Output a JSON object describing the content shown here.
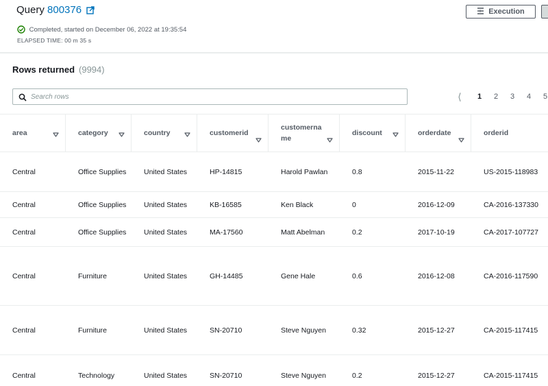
{
  "query": {
    "label": "Query",
    "id": "800376"
  },
  "status": {
    "text": "Completed, started on December 06, 2022 at 19:35:54",
    "elapsed": "ELAPSED TIME: 00 m 35 s"
  },
  "execution_button": {
    "label": "Execution"
  },
  "rows": {
    "title": "Rows returned",
    "count": "(9994)"
  },
  "search": {
    "placeholder": "Search rows"
  },
  "pagination": {
    "pages": [
      "1",
      "2",
      "3",
      "4",
      "5"
    ],
    "current": "1"
  },
  "columns": [
    "area",
    "category",
    "country",
    "customerid",
    "customername",
    "discount",
    "orderdate",
    "orderid"
  ],
  "table_rows": [
    [
      "Central",
      "Office Supplies",
      "United States",
      "HP-14815",
      "Harold Pawlan",
      "0.8",
      "2015-11-22",
      "US-2015-118983"
    ],
    [
      "Central",
      "Office Supplies",
      "United States",
      "KB-16585",
      "Ken Black",
      "0",
      "2016-12-09",
      "CA-2016-137330"
    ],
    [
      "Central",
      "Office Supplies",
      "United States",
      "MA-17560",
      "Matt Abelman",
      "0.2",
      "2017-10-19",
      "CA-2017-107727"
    ],
    [
      "Central",
      "Furniture",
      "United States",
      "GH-14485",
      "Gene Hale",
      "0.6",
      "2016-12-08",
      "CA-2016-117590"
    ],
    [
      "Central",
      "Furniture",
      "United States",
      "SN-20710",
      "Steve Nguyen",
      "0.32",
      "2015-12-27",
      "CA-2015-117415"
    ],
    [
      "Central",
      "Technology",
      "United States",
      "SN-20710",
      "Steve Nguyen",
      "0.2",
      "2015-12-27",
      "CA-2015-117415"
    ]
  ],
  "colors": {
    "link": "#0073bb",
    "success": "#1d8102",
    "border": "#eaeded"
  }
}
